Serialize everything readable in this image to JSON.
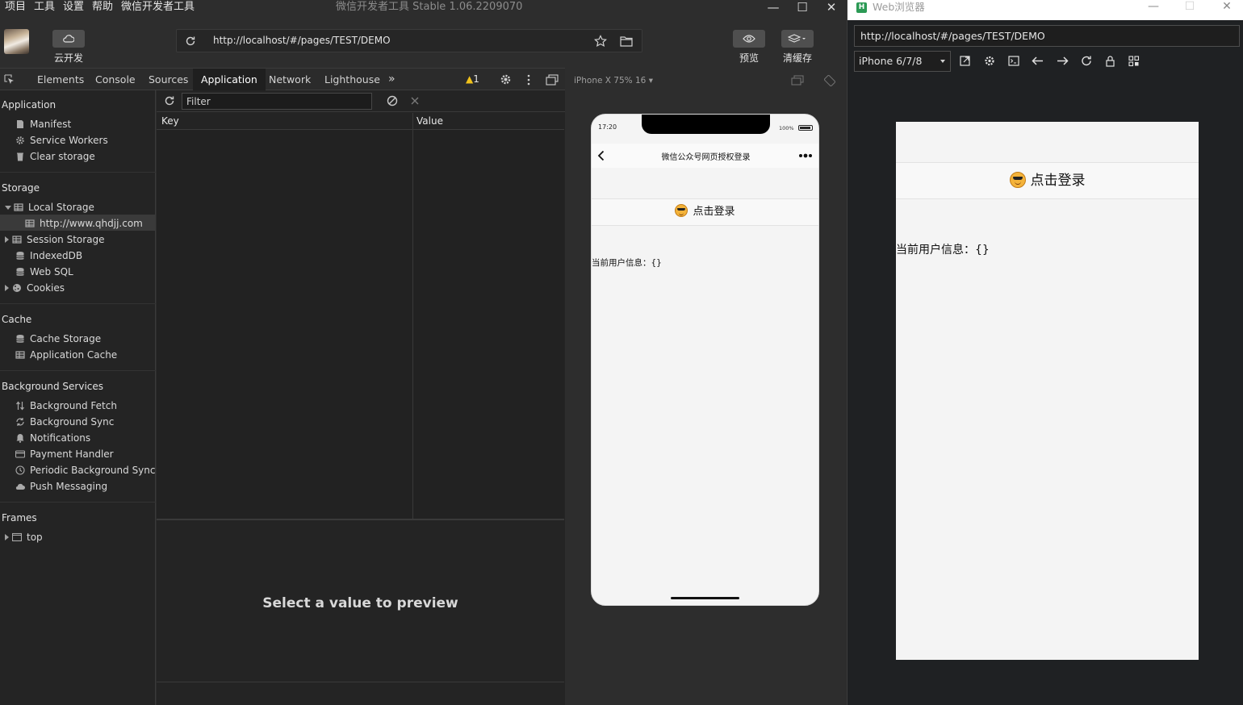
{
  "ide": {
    "menu": [
      "项目",
      "工具",
      "设置",
      "帮助",
      "微信开发者工具"
    ],
    "window_title": "微信开发者工具 Stable 1.06.2209070",
    "toolbar": {
      "cloud_label": "云开发",
      "url": "http://localhost/#/pages/TEST/DEMO",
      "preview_label": "预览",
      "clear_cache_label": "清缓存"
    },
    "devtools": {
      "tabs": [
        "Elements",
        "Console",
        "Sources",
        "Application",
        "Network",
        "Lighthouse"
      ],
      "active_tab": "Application",
      "warning_count": "1",
      "sidebar": {
        "application": {
          "title": "Application",
          "items": [
            "Manifest",
            "Service Workers",
            "Clear storage"
          ]
        },
        "storage": {
          "title": "Storage",
          "items": [
            "Local Storage",
            "http://www.qhdjj.com",
            "Session Storage",
            "IndexedDB",
            "Web SQL",
            "Cookies"
          ]
        },
        "cache": {
          "title": "Cache",
          "items": [
            "Cache Storage",
            "Application Cache"
          ]
        },
        "background_services": {
          "title": "Background Services",
          "items": [
            "Background Fetch",
            "Background Sync",
            "Notifications",
            "Payment Handler",
            "Periodic Background Sync",
            "Push Messaging"
          ]
        },
        "frames": {
          "title": "Frames",
          "items": [
            "top"
          ]
        }
      },
      "filter_placeholder": "Filter",
      "columns": {
        "key": "Key",
        "value": "Value"
      },
      "preview_text": "Select a value to preview"
    },
    "simulator": {
      "device_label": "iPhone X 75% 16",
      "status_time": "17:20",
      "battery": "100%",
      "nav_title": "微信公众号网页授权登录",
      "login_text": "点击登录",
      "user_info": "当前用户信息：{}"
    }
  },
  "browser": {
    "title": "Web浏览器",
    "logo_letter": "H",
    "url": "http://localhost/#/pages/TEST/DEMO",
    "device": "iPhone 6/7/8",
    "page": {
      "login_text": "点击登录",
      "user_info": "当前用户信息：{}"
    }
  }
}
